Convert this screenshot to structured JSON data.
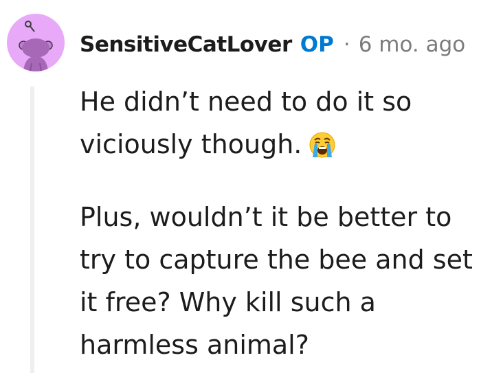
{
  "comment": {
    "author": "SensitiveCatLover",
    "op_badge": "OP",
    "separator": "·",
    "timestamp": "6 mo. ago",
    "paragraphs": [
      "He didn’t need to do it so viciously though.",
      "Plus, wouldn’t it be better to try to capture the bee and set it free? Why kill such a harmless animal?"
    ],
    "emoji": "loudly-crying-face-icon"
  },
  "colors": {
    "avatar_bg": "#e7a9f8",
    "op": "#0079d3",
    "meta": "#7c7c7c",
    "text": "#1c1c1c",
    "thread_line": "#edeff1"
  }
}
